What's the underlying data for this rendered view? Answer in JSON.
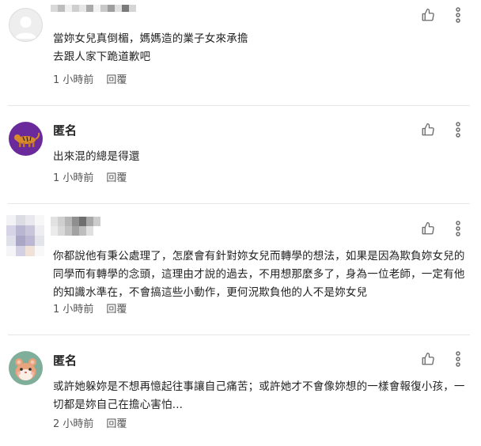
{
  "comments": [
    {
      "username": "",
      "body": "當妳女兒真倒楣，媽媽造的業子女來承擔\n去跟人家下跪道歉吧",
      "time": "1 小時前",
      "reply": "回覆",
      "avatar_icon": "default-user-avatar-icon"
    },
    {
      "username": "匿名",
      "body": "出來混的總是得還",
      "time": "1 小時前",
      "reply": "回覆",
      "avatar_icon": "tiger-avatar-icon",
      "avatar_color": "#6a2a9c"
    },
    {
      "username": "",
      "body": "你都說他有秉公處理了，怎麼會有針對妳女兒而轉學的想法，如果是因為欺負妳女兒的同學而有轉學的念頭，這理由才說的過去，不用想那麼多了，身為一位老師，一定有他的知識水準在，不會搞這些小動作，更何況欺負他的人不是妳女兒",
      "time": "1 小時前",
      "reply": "回覆",
      "avatar_icon": "pixelated-avatar-icon"
    },
    {
      "username": "匿名",
      "body": "或許她躲妳是不想再憶起往事讓自己痛苦；或許她才不會像妳想的一樣會報復小孩，一切都是妳自己在擔心害怕...",
      "time": "2 小時前",
      "reply": "回覆",
      "avatar_icon": "hamster-avatar-icon",
      "avatar_color": "#7fae9a"
    }
  ],
  "icons": {
    "like": "thumbs-up-icon",
    "more": "more-vertical-icon"
  }
}
